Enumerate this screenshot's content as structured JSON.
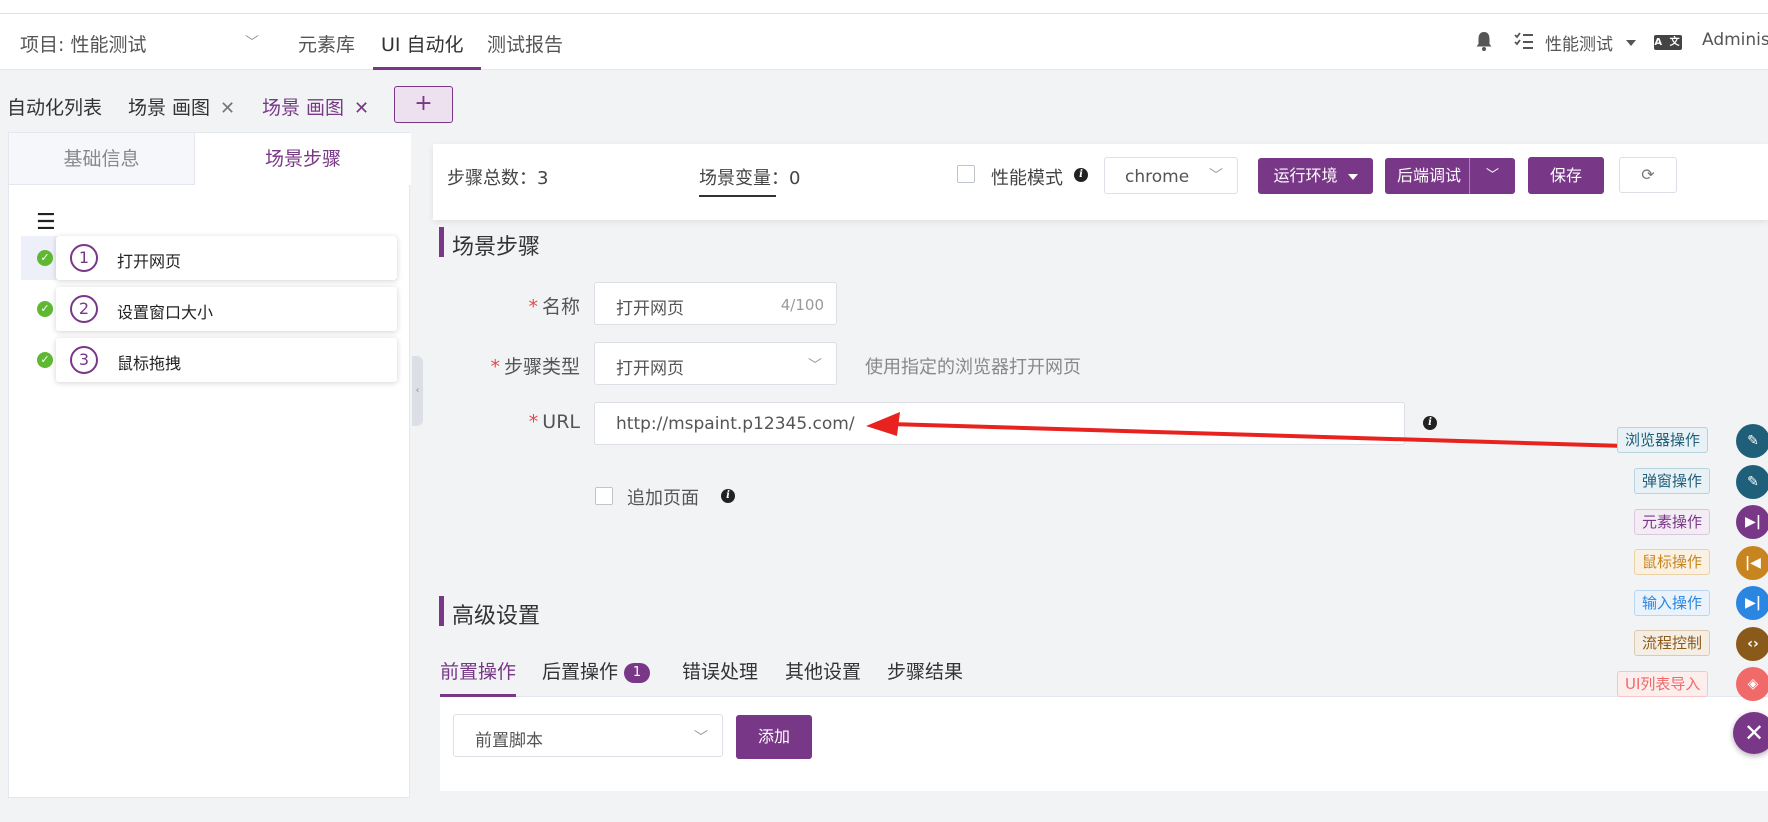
{
  "header": {
    "project": "项目: 性能测试",
    "nav": [
      "元素库",
      "UI 自动化",
      "测试报告"
    ],
    "workspace": "性能测试",
    "lang_icon": "A 文",
    "user": "Administrator"
  },
  "tabs": {
    "list": "自动化列表",
    "scene1": "场景 画图",
    "scene2": "场景 画图",
    "add": "+"
  },
  "left_panel": {
    "tab_basic": "基础信息",
    "tab_steps": "场景步骤",
    "steps": [
      {
        "num": "1",
        "label": "打开网页"
      },
      {
        "num": "2",
        "label": "设置窗口大小"
      },
      {
        "num": "3",
        "label": "鼠标拖拽"
      }
    ]
  },
  "toolbar": {
    "step_total": "步骤总数：3",
    "scene_vars": "场景变量：0",
    "perf_mode": "性能模式",
    "browser": "chrome",
    "run_env": "运行环境",
    "backend_debug": "后端调试",
    "save": "保存"
  },
  "step_form": {
    "section_title": "场景步骤",
    "name_label": "名称",
    "name_value": "打开网页",
    "name_count": "4/100",
    "type_label": "步骤类型",
    "type_value": "打开网页",
    "type_hint": "使用指定的浏览器打开网页",
    "url_label": "URL",
    "url_value": "http://mspaint.p12345.com/",
    "append_page": "追加页面"
  },
  "advanced": {
    "title": "高级设置",
    "tabs": [
      "前置操作",
      "后置操作",
      "错误处理",
      "其他设置",
      "步骤结果"
    ],
    "post_badge": "1",
    "script_select": "前置脚本",
    "add_button": "添加"
  },
  "float_menu": [
    {
      "label": "浏览器操作",
      "icon": "pen-icon",
      "color": "#1f5f7a"
    },
    {
      "label": "弹窗操作",
      "icon": "pen-icon",
      "color": "#1f5f7a"
    },
    {
      "label": "元素操作",
      "icon": "skip-forward-icon",
      "color": "#783887"
    },
    {
      "label": "鼠标操作",
      "icon": "skip-back-icon",
      "color": "#c8851f"
    },
    {
      "label": "输入操作",
      "icon": "skip-forward-icon",
      "color": "#2a86e0"
    },
    {
      "label": "流程控制",
      "icon": "code-icon",
      "color": "#8a5a1a"
    },
    {
      "label": "UI列表导入",
      "icon": "import-icon",
      "color": "#f06a6a"
    }
  ]
}
